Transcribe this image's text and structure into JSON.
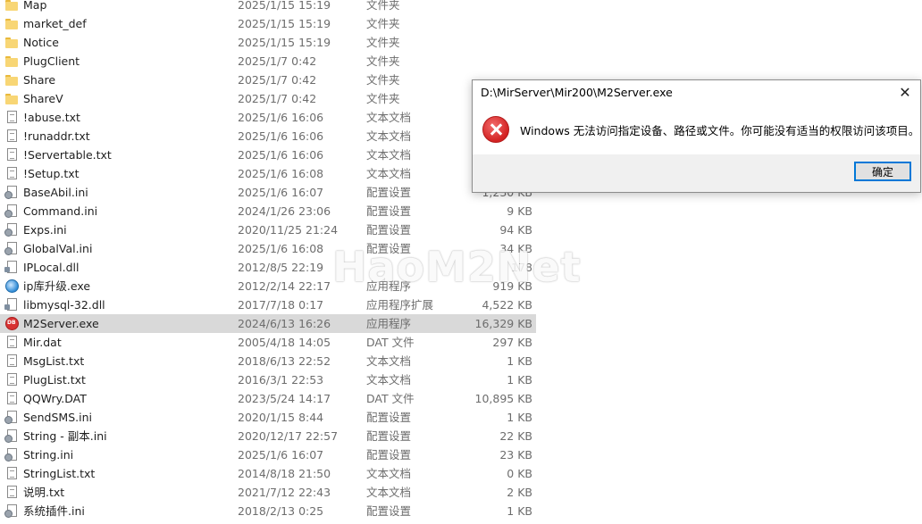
{
  "files": [
    {
      "name": "Map",
      "date": "2025/1/15 15:19",
      "type": "文件夹",
      "size": "",
      "icon": "folder-icon"
    },
    {
      "name": "market_def",
      "date": "2025/1/15 15:19",
      "type": "文件夹",
      "size": "",
      "icon": "folder-icon"
    },
    {
      "name": "Notice",
      "date": "2025/1/15 15:19",
      "type": "文件夹",
      "size": "",
      "icon": "folder-icon"
    },
    {
      "name": "PlugClient",
      "date": "2025/1/7 0:42",
      "type": "文件夹",
      "size": "",
      "icon": "folder-icon"
    },
    {
      "name": "Share",
      "date": "2025/1/7 0:42",
      "type": "文件夹",
      "size": "",
      "icon": "folder-icon"
    },
    {
      "name": "ShareV",
      "date": "2025/1/7 0:42",
      "type": "文件夹",
      "size": "",
      "icon": "folder-icon"
    },
    {
      "name": "!abuse.txt",
      "date": "2025/1/6 16:06",
      "type": "文本文档",
      "size": "",
      "icon": "text-file-icon"
    },
    {
      "name": "!runaddr.txt",
      "date": "2025/1/6 16:06",
      "type": "文本文档",
      "size": "",
      "icon": "text-file-icon"
    },
    {
      "name": "!Servertable.txt",
      "date": "2025/1/6 16:06",
      "type": "文本文档",
      "size": "",
      "icon": "text-file-icon"
    },
    {
      "name": "!Setup.txt",
      "date": "2025/1/6 16:08",
      "type": "文本文档",
      "size": "",
      "icon": "text-file-icon"
    },
    {
      "name": "BaseAbil.ini",
      "date": "2025/1/6 16:07",
      "type": "配置设置",
      "size": "1,230 KB",
      "icon": "config-file-icon"
    },
    {
      "name": "Command.ini",
      "date": "2024/1/26 23:06",
      "type": "配置设置",
      "size": "9 KB",
      "icon": "config-file-icon"
    },
    {
      "name": "Exps.ini",
      "date": "2020/11/25 21:24",
      "type": "配置设置",
      "size": "94 KB",
      "icon": "config-file-icon"
    },
    {
      "name": "GlobalVal.ini",
      "date": "2025/1/6 16:08",
      "type": "配置设置",
      "size": "34 KB",
      "icon": "config-file-icon"
    },
    {
      "name": "IPLocal.dll",
      "date": "2012/8/5 22:19",
      "type": "",
      "size": "178",
      "icon": "dll-file-icon"
    },
    {
      "name": "ip库升级.exe",
      "date": "2012/2/14 22:17",
      "type": "应用程序",
      "size": "919 KB",
      "icon": "app-blue-icon"
    },
    {
      "name": "libmysql-32.dll",
      "date": "2017/7/18 0:17",
      "type": "应用程序扩展",
      "size": "4,522 KB",
      "icon": "dll-file-icon"
    },
    {
      "name": "M2Server.exe",
      "date": "2024/6/13 16:26",
      "type": "应用程序",
      "size": "16,329 KB",
      "icon": "app-red-icon",
      "selected": true
    },
    {
      "name": "Mir.dat",
      "date": "2005/4/18 14:05",
      "type": "DAT 文件",
      "size": "297 KB",
      "icon": "blank-file-icon"
    },
    {
      "name": "MsgList.txt",
      "date": "2018/6/13 22:52",
      "type": "文本文档",
      "size": "1 KB",
      "icon": "text-file-icon"
    },
    {
      "name": "PlugList.txt",
      "date": "2016/3/1 22:53",
      "type": "文本文档",
      "size": "1 KB",
      "icon": "text-file-icon"
    },
    {
      "name": "QQWry.DAT",
      "date": "2023/5/24 14:17",
      "type": "DAT 文件",
      "size": "10,895 KB",
      "icon": "blank-file-icon"
    },
    {
      "name": "SendSMS.ini",
      "date": "2020/1/15 8:44",
      "type": "配置设置",
      "size": "1 KB",
      "icon": "config-file-icon"
    },
    {
      "name": "String - 副本.ini",
      "date": "2020/12/17 22:57",
      "type": "配置设置",
      "size": "22 KB",
      "icon": "config-file-icon"
    },
    {
      "name": "String.ini",
      "date": "2025/1/6 16:07",
      "type": "配置设置",
      "size": "23 KB",
      "icon": "config-file-icon"
    },
    {
      "name": "StringList.txt",
      "date": "2014/8/18 21:50",
      "type": "文本文档",
      "size": "0 KB",
      "icon": "text-file-icon"
    },
    {
      "name": "说明.txt",
      "date": "2021/7/12 22:43",
      "type": "文本文档",
      "size": "2 KB",
      "icon": "text-file-icon"
    },
    {
      "name": "系统插件.ini",
      "date": "2018/2/13 0:25",
      "type": "配置设置",
      "size": "1 KB",
      "icon": "config-file-icon"
    }
  ],
  "dialog": {
    "title": "D:\\MirServer\\Mir200\\M2Server.exe",
    "message": "Windows 无法访问指定设备、路径或文件。你可能没有适当的权限访问该项目。",
    "ok_label": "确定",
    "close_symbol": "✕"
  },
  "watermark": "HaoM2Net"
}
